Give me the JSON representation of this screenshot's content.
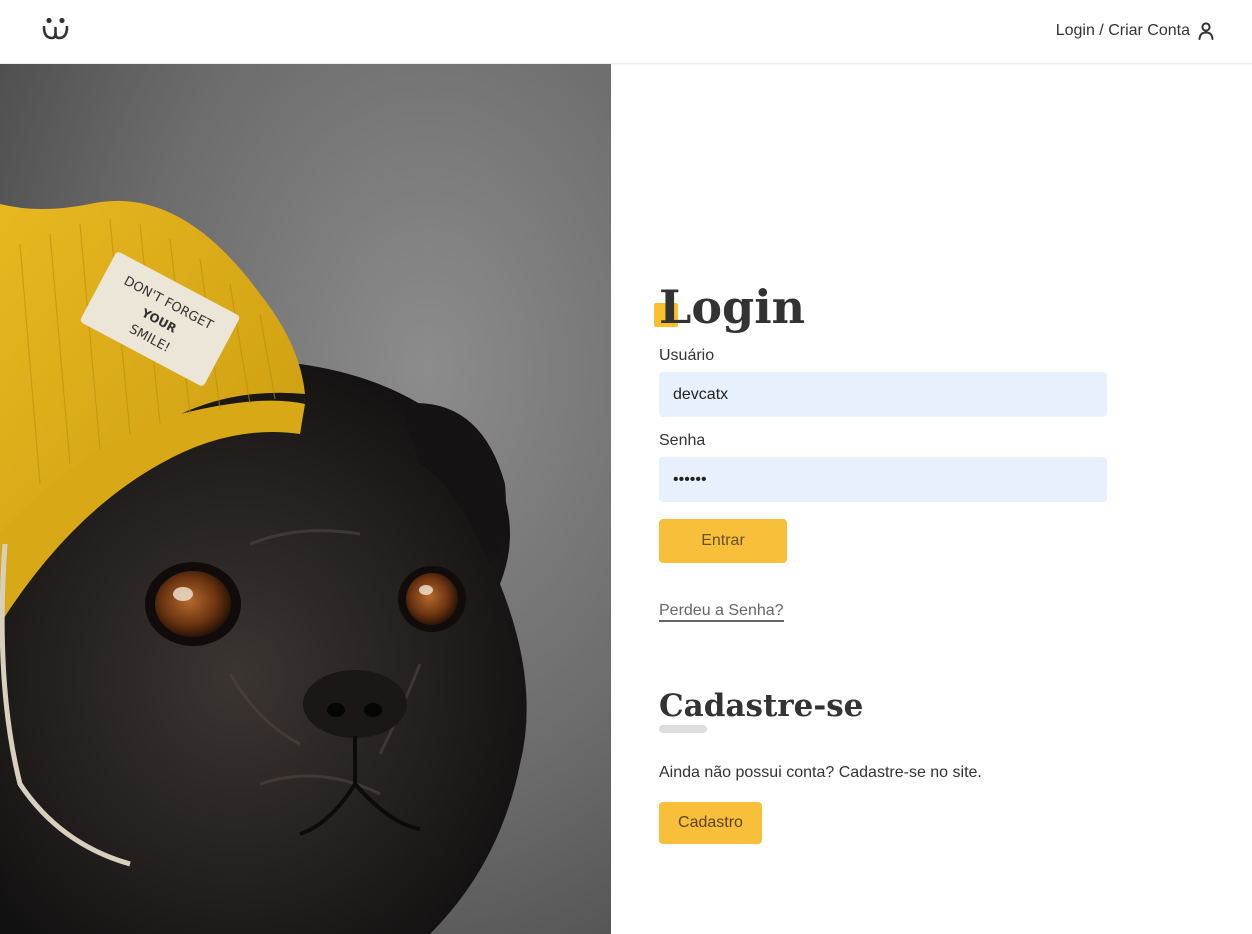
{
  "header": {
    "logo_icon": "dog-face-logo-icon",
    "login_link_label": "Login / Criar Conta",
    "user_icon": "user-icon"
  },
  "hero": {
    "image": "pug-with-yellow-beanie-photo",
    "hat_patch_text": "DON'T FORGET YOUR SMILE!"
  },
  "login": {
    "title": "Login",
    "username_label": "Usuário",
    "username_value": "devcatx",
    "password_label": "Senha",
    "password_value": "dogpwd",
    "submit_label": "Entrar",
    "lost_password_label": "Perdeu a Senha?"
  },
  "signup": {
    "title": "Cadastre-se",
    "description": "Ainda não possui conta? Cadastre-se no site.",
    "button_label": "Cadastro"
  },
  "colors": {
    "accent": "#fbc02d",
    "button": "#f7bf3a",
    "input_bg": "#e8f0fe",
    "text": "#333333"
  }
}
